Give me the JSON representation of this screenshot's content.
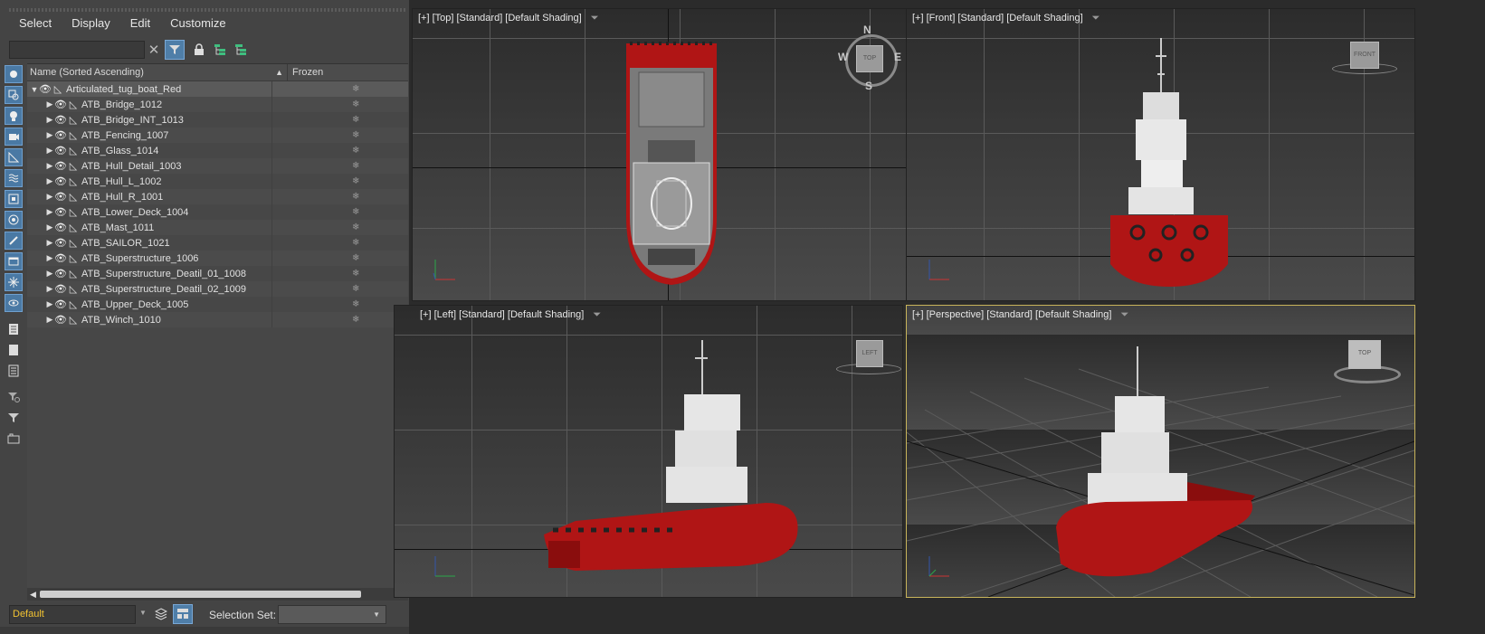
{
  "menu": [
    "Select",
    "Display",
    "Edit",
    "Customize"
  ],
  "search": {
    "placeholder": ""
  },
  "tree": {
    "col_name": "Name (Sorted Ascending)",
    "col_frozen": "Frozen",
    "root": "Articulated_tug_boat_Red",
    "children": [
      "ATB_Bridge_1012",
      "ATB_Bridge_INT_1013",
      "ATB_Fencing_1007",
      "ATB_Glass_1014",
      "ATB_Hull_Detail_1003",
      "ATB_Hull_L_1002",
      "ATB_Hull_R_1001",
      "ATB_Lower_Deck_1004",
      "ATB_Mast_1011",
      "ATB_SAILOR_1021",
      "ATB_Superstructure_1006",
      "ATB_Superstructure_Deatil_01_1008",
      "ATB_Superstructure_Deatil_02_1009",
      "ATB_Upper_Deck_1005",
      "ATB_Winch_1010"
    ]
  },
  "bottom": {
    "layer": "Default",
    "selection_set_label": "Selection Set:"
  },
  "viewports": {
    "top": "[+] [Top] [Standard] [Default Shading]",
    "front": "[+] [Front] [Standard] [Default Shading]",
    "left": "[+] [Left] [Standard] [Default Shading]",
    "perspective": "[+] [Perspective] [Standard] [Default Shading]"
  },
  "viewcube": {
    "top": "TOP",
    "front": "FRONT",
    "left": "LEFT",
    "persp": "TOP",
    "n": "N",
    "s": "S",
    "e": "E",
    "w": "W"
  },
  "colors": {
    "hull_red": "#b01515",
    "superstructure": "#e8e8e8",
    "active_border": "#c8b45a",
    "accent_blue": "#4f7ea8"
  }
}
